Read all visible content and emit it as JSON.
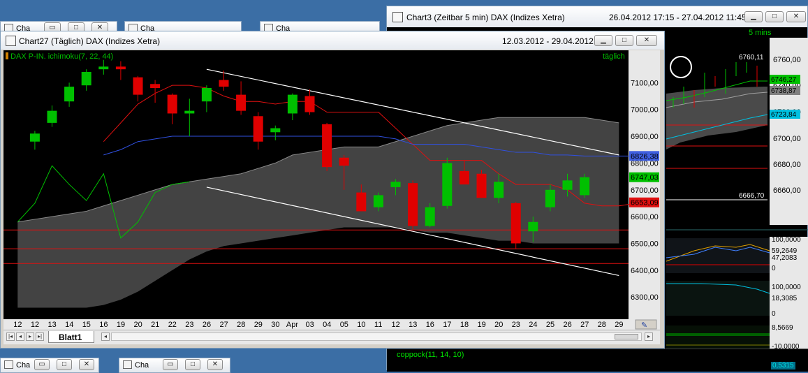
{
  "background_tabs": {
    "top": [
      {
        "label": "Cha"
      },
      {
        "label": "Cha"
      },
      {
        "label": "Cha"
      }
    ],
    "bottom": [
      {
        "label": "Cha"
      },
      {
        "label": "Cha"
      }
    ]
  },
  "chart3": {
    "title": "Chart3 (Zeitbar 5 min)  DAX (Indizes Xetra)",
    "range": "26.04.2012 17:15 - 27.04.2012 11:45",
    "period_label": "5 mins",
    "y_labels": [
      "6760,00",
      "6740,00",
      "6720,00",
      "6700,00",
      "6680,00",
      "6660,00"
    ],
    "price_tags": [
      {
        "text": "6746,27",
        "color": "#00c000"
      },
      {
        "text": "6738,87",
        "color": "#808080"
      },
      {
        "text": "6723,84",
        "color": "#00c0e0"
      }
    ],
    "high_label": "6760,11",
    "low_label": "6666,70",
    "panel2_labels": [
      "100,0000",
      "59,2649",
      "47,2083",
      "0"
    ],
    "panel3_labels": [
      "100,0000",
      "18,3085",
      "0"
    ],
    "panel4_labels": [
      "8,5669",
      "-10,0000"
    ],
    "coppock_label": "coppock(11, 14, 10)",
    "coppock_value": "0,5315"
  },
  "chart27": {
    "title": "Chart27 (Täglich)  DAX (Indizes Xetra)",
    "range": "12.03.2012 - 29.04.2012",
    "indicator_label": "DAX P-IN. ichimoku(7, 22, 44)",
    "period_label": "täglich",
    "y_labels": [
      "7100,00",
      "7000,00",
      "6900,00",
      "6800,00",
      "6700,00",
      "6600,00",
      "6500,00",
      "6400,00",
      "6300,00"
    ],
    "price_tags": [
      {
        "text": "6826,38",
        "color": "#4060e0",
        "value": 6826.38
      },
      {
        "text": "6747,03",
        "color": "#00c000",
        "value": 6747.03
      },
      {
        "text": "6653,09",
        "color": "#e01010",
        "value": 6653.09
      }
    ],
    "x_labels": [
      "12",
      "12",
      "13",
      "14",
      "15",
      "16",
      "19",
      "20",
      "21",
      "22",
      "23",
      "26",
      "27",
      "28",
      "29",
      "30",
      "Apr",
      "03",
      "04",
      "05",
      "10",
      "11",
      "12",
      "13",
      "16",
      "17",
      "18",
      "19",
      "20",
      "23",
      "24",
      "25",
      "26",
      "27",
      "28",
      "29"
    ],
    "sheet_tab": "Blatt1",
    "colors": {
      "up": "#00c000",
      "down": "#e00000",
      "cloud": "#606060",
      "kijun": "#3050e0",
      "tenkan": "#e01010",
      "chikou": "#00c000"
    }
  },
  "chart_data": {
    "type": "candlestick",
    "series_name": "DAX",
    "ylim": [
      6230,
      7200
    ],
    "y_ticks": [
      7100,
      7000,
      6900,
      6800,
      6700,
      6600,
      6500,
      6400,
      6300
    ],
    "categories": [
      "12",
      "13",
      "14",
      "15",
      "16",
      "19",
      "20",
      "21",
      "22",
      "23",
      "26",
      "27",
      "28",
      "29",
      "30",
      "Apr",
      "03",
      "04",
      "05",
      "10",
      "11",
      "12",
      "13",
      "16",
      "17",
      "18",
      "19",
      "20",
      "23",
      "24",
      "25",
      "26",
      "27"
    ],
    "candles": [
      {
        "o": 6880,
        "h": 6920,
        "l": 6850,
        "c": 6910
      },
      {
        "o": 6950,
        "h": 7015,
        "l": 6935,
        "c": 6995
      },
      {
        "o": 7030,
        "h": 7100,
        "l": 7010,
        "c": 7085
      },
      {
        "o": 7090,
        "h": 7150,
        "l": 7070,
        "c": 7140
      },
      {
        "o": 7150,
        "h": 7185,
        "l": 7130,
        "c": 7160
      },
      {
        "o": 7160,
        "h": 7180,
        "l": 7110,
        "c": 7150
      },
      {
        "o": 7120,
        "h": 7125,
        "l": 7030,
        "c": 7055
      },
      {
        "o": 7095,
        "h": 7110,
        "l": 7025,
        "c": 7080
      },
      {
        "o": 7055,
        "h": 7060,
        "l": 6945,
        "c": 6985
      },
      {
        "o": 6985,
        "h": 7040,
        "l": 6900,
        "c": 6995
      },
      {
        "o": 7030,
        "h": 7090,
        "l": 6990,
        "c": 7080
      },
      {
        "o": 7110,
        "h": 7145,
        "l": 7070,
        "c": 7085
      },
      {
        "o": 7055,
        "h": 7105,
        "l": 6980,
        "c": 6995
      },
      {
        "o": 6975,
        "h": 6990,
        "l": 6850,
        "c": 6880
      },
      {
        "o": 6915,
        "h": 6940,
        "l": 6885,
        "c": 6930
      },
      {
        "o": 6985,
        "h": 7060,
        "l": 6960,
        "c": 7055
      },
      {
        "o": 7050,
        "h": 7075,
        "l": 6980,
        "c": 6990
      },
      {
        "o": 6945,
        "h": 6950,
        "l": 6770,
        "c": 6785
      },
      {
        "o": 6820,
        "h": 6830,
        "l": 6700,
        "c": 6790
      },
      {
        "o": 6690,
        "h": 6720,
        "l": 6620,
        "c": 6620
      },
      {
        "o": 6635,
        "h": 6690,
        "l": 6620,
        "c": 6680
      },
      {
        "o": 6710,
        "h": 6740,
        "l": 6680,
        "c": 6730
      },
      {
        "o": 6725,
        "h": 6735,
        "l": 6550,
        "c": 6565
      },
      {
        "o": 6565,
        "h": 6650,
        "l": 6560,
        "c": 6635
      },
      {
        "o": 6640,
        "h": 6820,
        "l": 6630,
        "c": 6800
      },
      {
        "o": 6770,
        "h": 6810,
        "l": 6720,
        "c": 6720
      },
      {
        "o": 6760,
        "h": 6775,
        "l": 6670,
        "c": 6670
      },
      {
        "o": 6670,
        "h": 6760,
        "l": 6650,
        "c": 6730
      },
      {
        "o": 6650,
        "h": 6655,
        "l": 6480,
        "c": 6500
      },
      {
        "o": 6545,
        "h": 6600,
        "l": 6505,
        "c": 6580
      },
      {
        "o": 6635,
        "h": 6720,
        "l": 6620,
        "c": 6700
      },
      {
        "o": 6700,
        "h": 6760,
        "l": 6675,
        "c": 6735
      },
      {
        "o": 6680,
        "h": 6760,
        "l": 6670,
        "c": 6747
      }
    ],
    "tenkan": [
      6880,
      6950,
      7020,
      7060,
      7090,
      7090,
      7080,
      7050,
      7030,
      7030,
      7020,
      7030,
      7030,
      6990,
      6990,
      6990,
      6990,
      6930,
      6870,
      6810,
      6810,
      6810,
      6810,
      6760,
      6720,
      6720,
      6720,
      6700,
      6650,
      6640,
      6640,
      6650,
      6653
    ],
    "kijun": [
      6830,
      6850,
      6880,
      6890,
      6900,
      6900,
      6900,
      6900,
      6900,
      6900,
      6900,
      6900,
      6900,
      6900,
      6900,
      6900,
      6900,
      6890,
      6870,
      6870,
      6870,
      6870,
      6860,
      6850,
      6840,
      6840,
      6830,
      6830,
      6826,
      6826,
      6826,
      6826,
      6826
    ],
    "chikou": [
      6580,
      6650,
      6790,
      6720,
      6660,
      6760,
      6520,
      6580,
      6690,
      6720,
      6730
    ],
    "cloud_upper": [
      6580,
      6590,
      6600,
      6610,
      6620,
      6640,
      6660,
      6680,
      6700,
      6720,
      6730,
      6740,
      6750,
      6760,
      6780,
      6800,
      6830,
      6840,
      6850,
      6860,
      6860,
      6860,
      6880,
      6900,
      6920,
      6940,
      6950,
      6960,
      6970,
      6970,
      6970,
      6970,
      6970,
      6970,
      6960,
      6950
    ],
    "cloud_lower": [
      6260,
      6260,
      6260,
      6260,
      6260,
      6270,
      6290,
      6320,
      6360,
      6400,
      6440,
      6470,
      6490,
      6500,
      6510,
      6520,
      6530,
      6540,
      6550,
      6560,
      6560,
      6560,
      6560,
      6550,
      6540,
      6540,
      6530,
      6520,
      6510,
      6510,
      6500,
      6500,
      6500,
      6500,
      6500,
      6500
    ],
    "horizontal_lines": [
      6550,
      6480,
      6425
    ],
    "trend_lines": [
      {
        "from_index": 11,
        "from_value": 7150,
        "to_index": 35,
        "to_value": 6830
      },
      {
        "from_index": 11,
        "from_value": 6710,
        "to_index": 35,
        "to_value": 6380
      }
    ],
    "grid": false,
    "title": "",
    "xlabel": "",
    "ylabel": ""
  }
}
